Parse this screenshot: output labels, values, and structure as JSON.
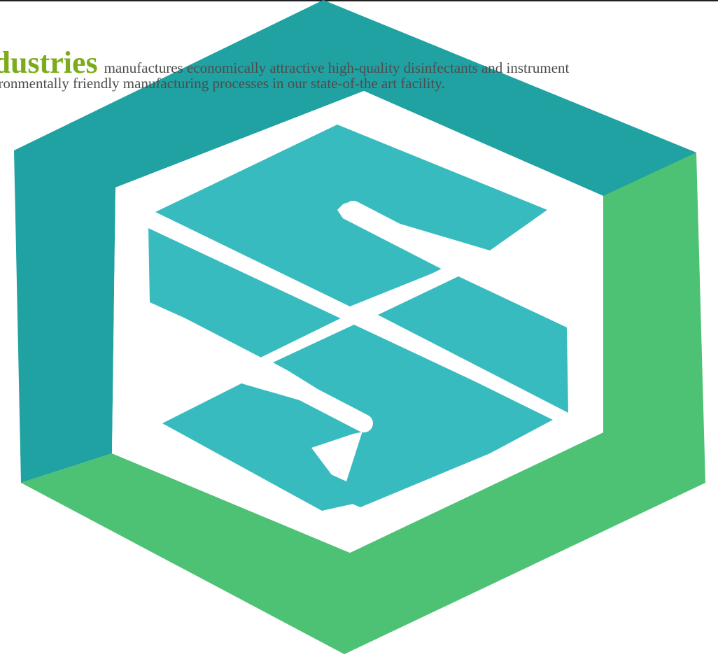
{
  "intro": {
    "brand_word": "ndustries",
    "line1_text": "manufactures economically attractive high-quality disinfectants and instrument",
    "line2_text": "vironmentally friendly manufacturing processes in our state-of-the art facility."
  },
  "logo": {
    "icon": "hexagon-s-cube-logo-icon",
    "colors": {
      "outer_teal": "#20a1a2",
      "outer_green": "#4ec274",
      "inner_white": "#ffffff",
      "panel_teal": "#38bbbf"
    }
  }
}
